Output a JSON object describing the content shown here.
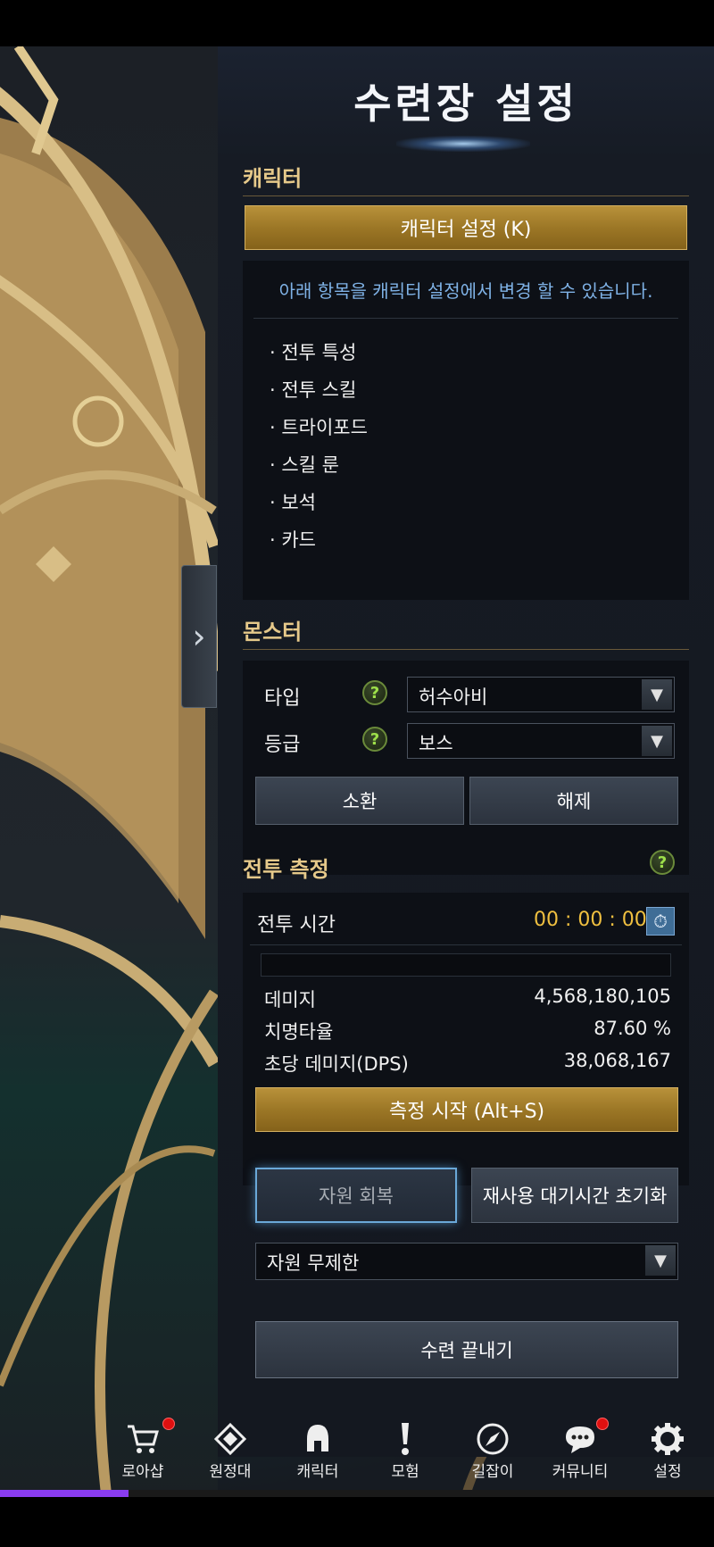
{
  "panel": {
    "title": "수련장 설정"
  },
  "character": {
    "section_title": "캐릭터",
    "settings_button": "캐릭터 설정 (K)",
    "note": "아래 항목을 캐릭터 설정에서 변경 할 수 있습니다.",
    "items": [
      "· 전투 특성",
      "· 전투 스킬",
      "· 트라이포드",
      "· 스킬 룬",
      "· 보석",
      "· 카드"
    ]
  },
  "monster": {
    "section_title": "몬스터",
    "type_label": "타입",
    "type_value": "허수아비",
    "grade_label": "등급",
    "grade_value": "보스",
    "summon_button": "소환",
    "release_button": "해제"
  },
  "combat": {
    "section_title": "전투 측정",
    "time_label": "전투 시간",
    "time_value": "00 : 00 : 00",
    "damage_label": "데미지",
    "damage_value": "4,568,180,105",
    "crit_label": "치명타율",
    "crit_value": "87.60 %",
    "dps_label": "초당 데미지(DPS)",
    "dps_value": "38,068,167",
    "start_button": "측정 시작 (Alt+S)"
  },
  "resources": {
    "recover_button": "자원 회복",
    "cooldown_button": "재사용 대기시간 초기화",
    "mode_value": "자원 무제한"
  },
  "end_button": "수련 끝내기",
  "nav": [
    {
      "label": "로아샵",
      "icon": "cart-icon",
      "badge": true
    },
    {
      "label": "원정대",
      "icon": "expedition-icon",
      "badge": false
    },
    {
      "label": "캐릭터",
      "icon": "helmet-icon",
      "badge": false
    },
    {
      "label": "모험",
      "icon": "exclamation-icon",
      "badge": false
    },
    {
      "label": "길잡이",
      "icon": "compass-icon",
      "badge": false
    },
    {
      "label": "커뮤니티",
      "icon": "chat-icon",
      "badge": true
    },
    {
      "label": "설정",
      "icon": "gear-icon",
      "badge": false
    }
  ],
  "colors": {
    "gold_accent": "#e6c98a",
    "timer": "#f0c040",
    "note_blue": "#7fb2e6",
    "progress_purple": "#8a3cf0",
    "help_green": "#9ee04a"
  },
  "bottom_progress": 0.18
}
